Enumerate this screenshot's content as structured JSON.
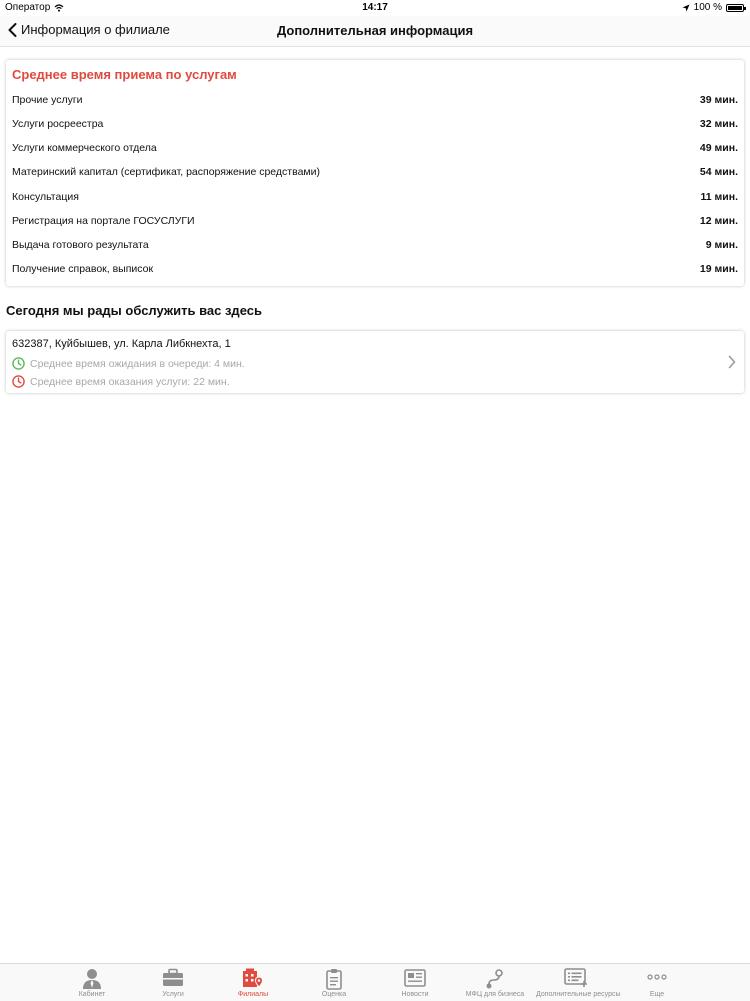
{
  "status_bar": {
    "carrier": "Оператор",
    "time": "14:17",
    "battery": "100 %"
  },
  "nav": {
    "back_label": "Информация о филиале",
    "title": "Дополнительная информация"
  },
  "services_card": {
    "title": "Среднее время приема по услугам",
    "rows": [
      {
        "name": "Прочие услуги",
        "time": "39 мин."
      },
      {
        "name": "Услуги росреестра",
        "time": "32 мин."
      },
      {
        "name": "Услуги коммерческого отдела",
        "time": "49 мин."
      },
      {
        "name": "Материнский капитал (сертификат, распоряжение средствами)",
        "time": "54 мин."
      },
      {
        "name": "Консультация",
        "time": "11 мин."
      },
      {
        "name": "Регистрация на портале ГОСУСЛУГИ",
        "time": "12 мин."
      },
      {
        "name": "Выдача готового результата",
        "time": "9 мин."
      },
      {
        "name": "Получение справок, выписок",
        "time": "19 мин."
      }
    ]
  },
  "branch_section": {
    "title": "Сегодня мы рады обслужить вас здесь",
    "address": "632387, Куйбышев, ул. Карла Либкнехта, 1",
    "wait_text": "Среднее время ожидания в очереди: 4 мин.",
    "service_text": "Среднее время оказания услуги: 22 мин."
  },
  "colors": {
    "accent": "#e04a3f",
    "wait_clock": "#5cb85c",
    "service_clock": "#e04a3f"
  },
  "tab_bar": {
    "active_index": 2,
    "tabs": [
      {
        "label": "Кабинет",
        "icon": "person-icon"
      },
      {
        "label": "Услуги",
        "icon": "briefcase-icon"
      },
      {
        "label": "Филиалы",
        "icon": "building-pin-icon"
      },
      {
        "label": "Оценка",
        "icon": "clipboard-icon"
      },
      {
        "label": "Новости",
        "icon": "newspaper-icon"
      },
      {
        "label": "МФЦ для бизнеса",
        "icon": "route-icon"
      },
      {
        "label": "Дополнительные ресурсы",
        "icon": "list-add-icon"
      },
      {
        "label": "Еще",
        "icon": "more-icon"
      }
    ]
  }
}
